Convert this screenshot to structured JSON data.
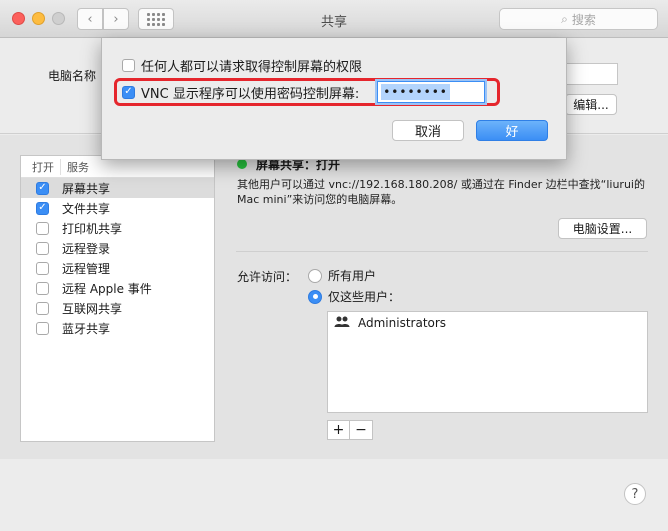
{
  "window": {
    "title": "共享"
  },
  "toolbar": {
    "search_placeholder": "搜索"
  },
  "computer_name": {
    "label": "电脑名称",
    "edit_label": "编辑..."
  },
  "services": {
    "header_open": "打开",
    "header_service": "服务",
    "items": [
      {
        "label": "屏幕共享",
        "checked": true,
        "selected": true
      },
      {
        "label": "文件共享",
        "checked": true,
        "selected": false
      },
      {
        "label": "打印机共享",
        "checked": false,
        "selected": false
      },
      {
        "label": "远程登录",
        "checked": false,
        "selected": false
      },
      {
        "label": "远程管理",
        "checked": false,
        "selected": false
      },
      {
        "label": "远程 Apple 事件",
        "checked": false,
        "selected": false
      },
      {
        "label": "互联网共享",
        "checked": false,
        "selected": false
      },
      {
        "label": "蓝牙共享",
        "checked": false,
        "selected": false
      }
    ]
  },
  "detail": {
    "status": "屏幕共享：打开",
    "description": "其他用户可以通过 vnc://192.168.180.208/ 或通过在 Finder 边栏中查找“liurui的 Mac mini”来访问您的电脑屏幕。",
    "computer_settings_label": "电脑设置...",
    "allow_access_label": "允许访问：",
    "all_users_label": "所有用户",
    "only_these_users_label": "仅这些用户：",
    "users": [
      "Administrators"
    ]
  },
  "sheet": {
    "option_anyone": "任何人都可以请求取得控制屏幕的权限",
    "option_vnc": "VNC 显示程序可以使用密码控制屏幕:",
    "password_value": "••••••••",
    "cancel_label": "取消",
    "ok_label": "好"
  },
  "colors": {
    "accent": "#3b8ef5",
    "highlight": "#e5262d",
    "status_on": "#28c23f"
  }
}
